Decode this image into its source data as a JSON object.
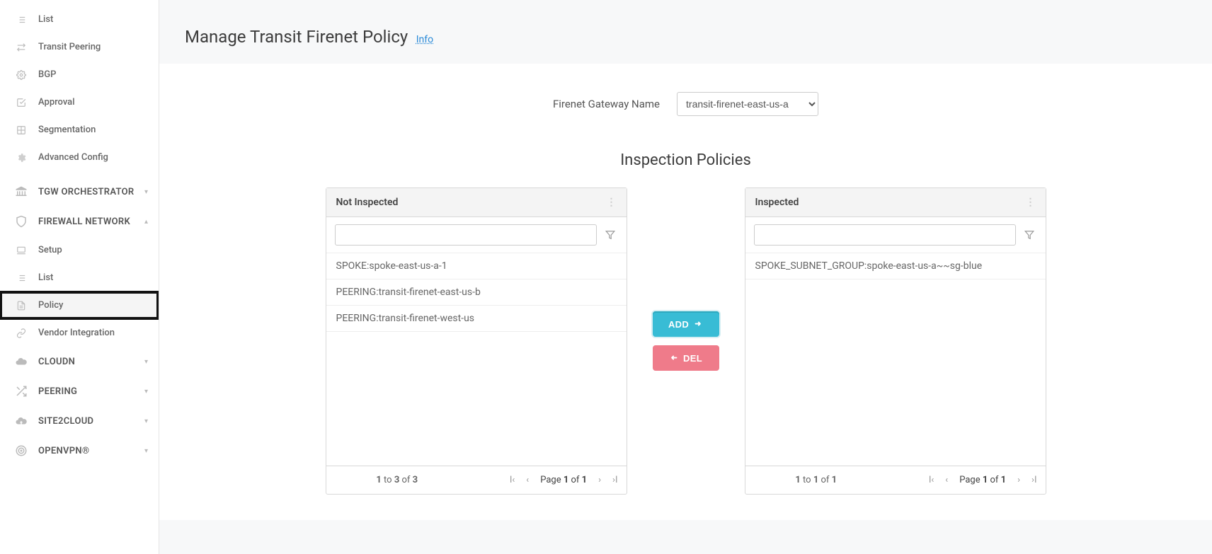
{
  "sidebar": {
    "items": [
      {
        "label": "List",
        "icon": "list-icon"
      },
      {
        "label": "Transit Peering",
        "icon": "swap-icon"
      },
      {
        "label": "BGP",
        "icon": "gear-outline-icon"
      },
      {
        "label": "Approval",
        "icon": "check-square-icon"
      },
      {
        "label": "Segmentation",
        "icon": "segment-icon"
      },
      {
        "label": "Advanced Config",
        "icon": "gear-icon"
      }
    ],
    "sections": [
      {
        "label": "TGW ORCHESTRATOR",
        "icon": "bank-icon",
        "expanded": false
      },
      {
        "label": "FIREWALL NETWORK",
        "icon": "shield-icon",
        "expanded": true,
        "children": [
          {
            "label": "Setup",
            "icon": "laptop-icon",
            "active": false
          },
          {
            "label": "List",
            "icon": "list-icon",
            "active": false
          },
          {
            "label": "Policy",
            "icon": "document-icon",
            "active": true
          },
          {
            "label": "Vendor Integration",
            "icon": "link-icon",
            "active": false
          }
        ]
      },
      {
        "label": "CLOUDN",
        "icon": "cloud-icon",
        "expanded": false
      },
      {
        "label": "PEERING",
        "icon": "shuffle-icon",
        "expanded": false
      },
      {
        "label": "SITE2CLOUD",
        "icon": "cloud-up-icon",
        "expanded": false
      },
      {
        "label": "OPENVPN®",
        "icon": "target-icon",
        "expanded": false
      }
    ]
  },
  "page": {
    "title": "Manage Transit Firenet Policy",
    "info_label": "Info",
    "gateway_label": "Firenet Gateway Name",
    "gateway_selected": "transit-firenet-east-us-a",
    "section_title": "Inspection Policies"
  },
  "panels": {
    "left": {
      "title": "Not Inspected",
      "filter": "",
      "rows": [
        "SPOKE:spoke-east-us-a-1",
        "PEERING:transit-firenet-east-us-b",
        "PEERING:transit-firenet-west-us"
      ],
      "range_html": "1 to 3 of 3",
      "page_html": "Page 1 of 1"
    },
    "right": {
      "title": "Inspected",
      "filter": "",
      "rows": [
        "SPOKE_SUBNET_GROUP:spoke-east-us-a~~sg-blue"
      ],
      "range_html": "1 to 1 of 1",
      "page_html": "Page 1 of 1"
    }
  },
  "buttons": {
    "add": "ADD",
    "del": "DEL"
  }
}
